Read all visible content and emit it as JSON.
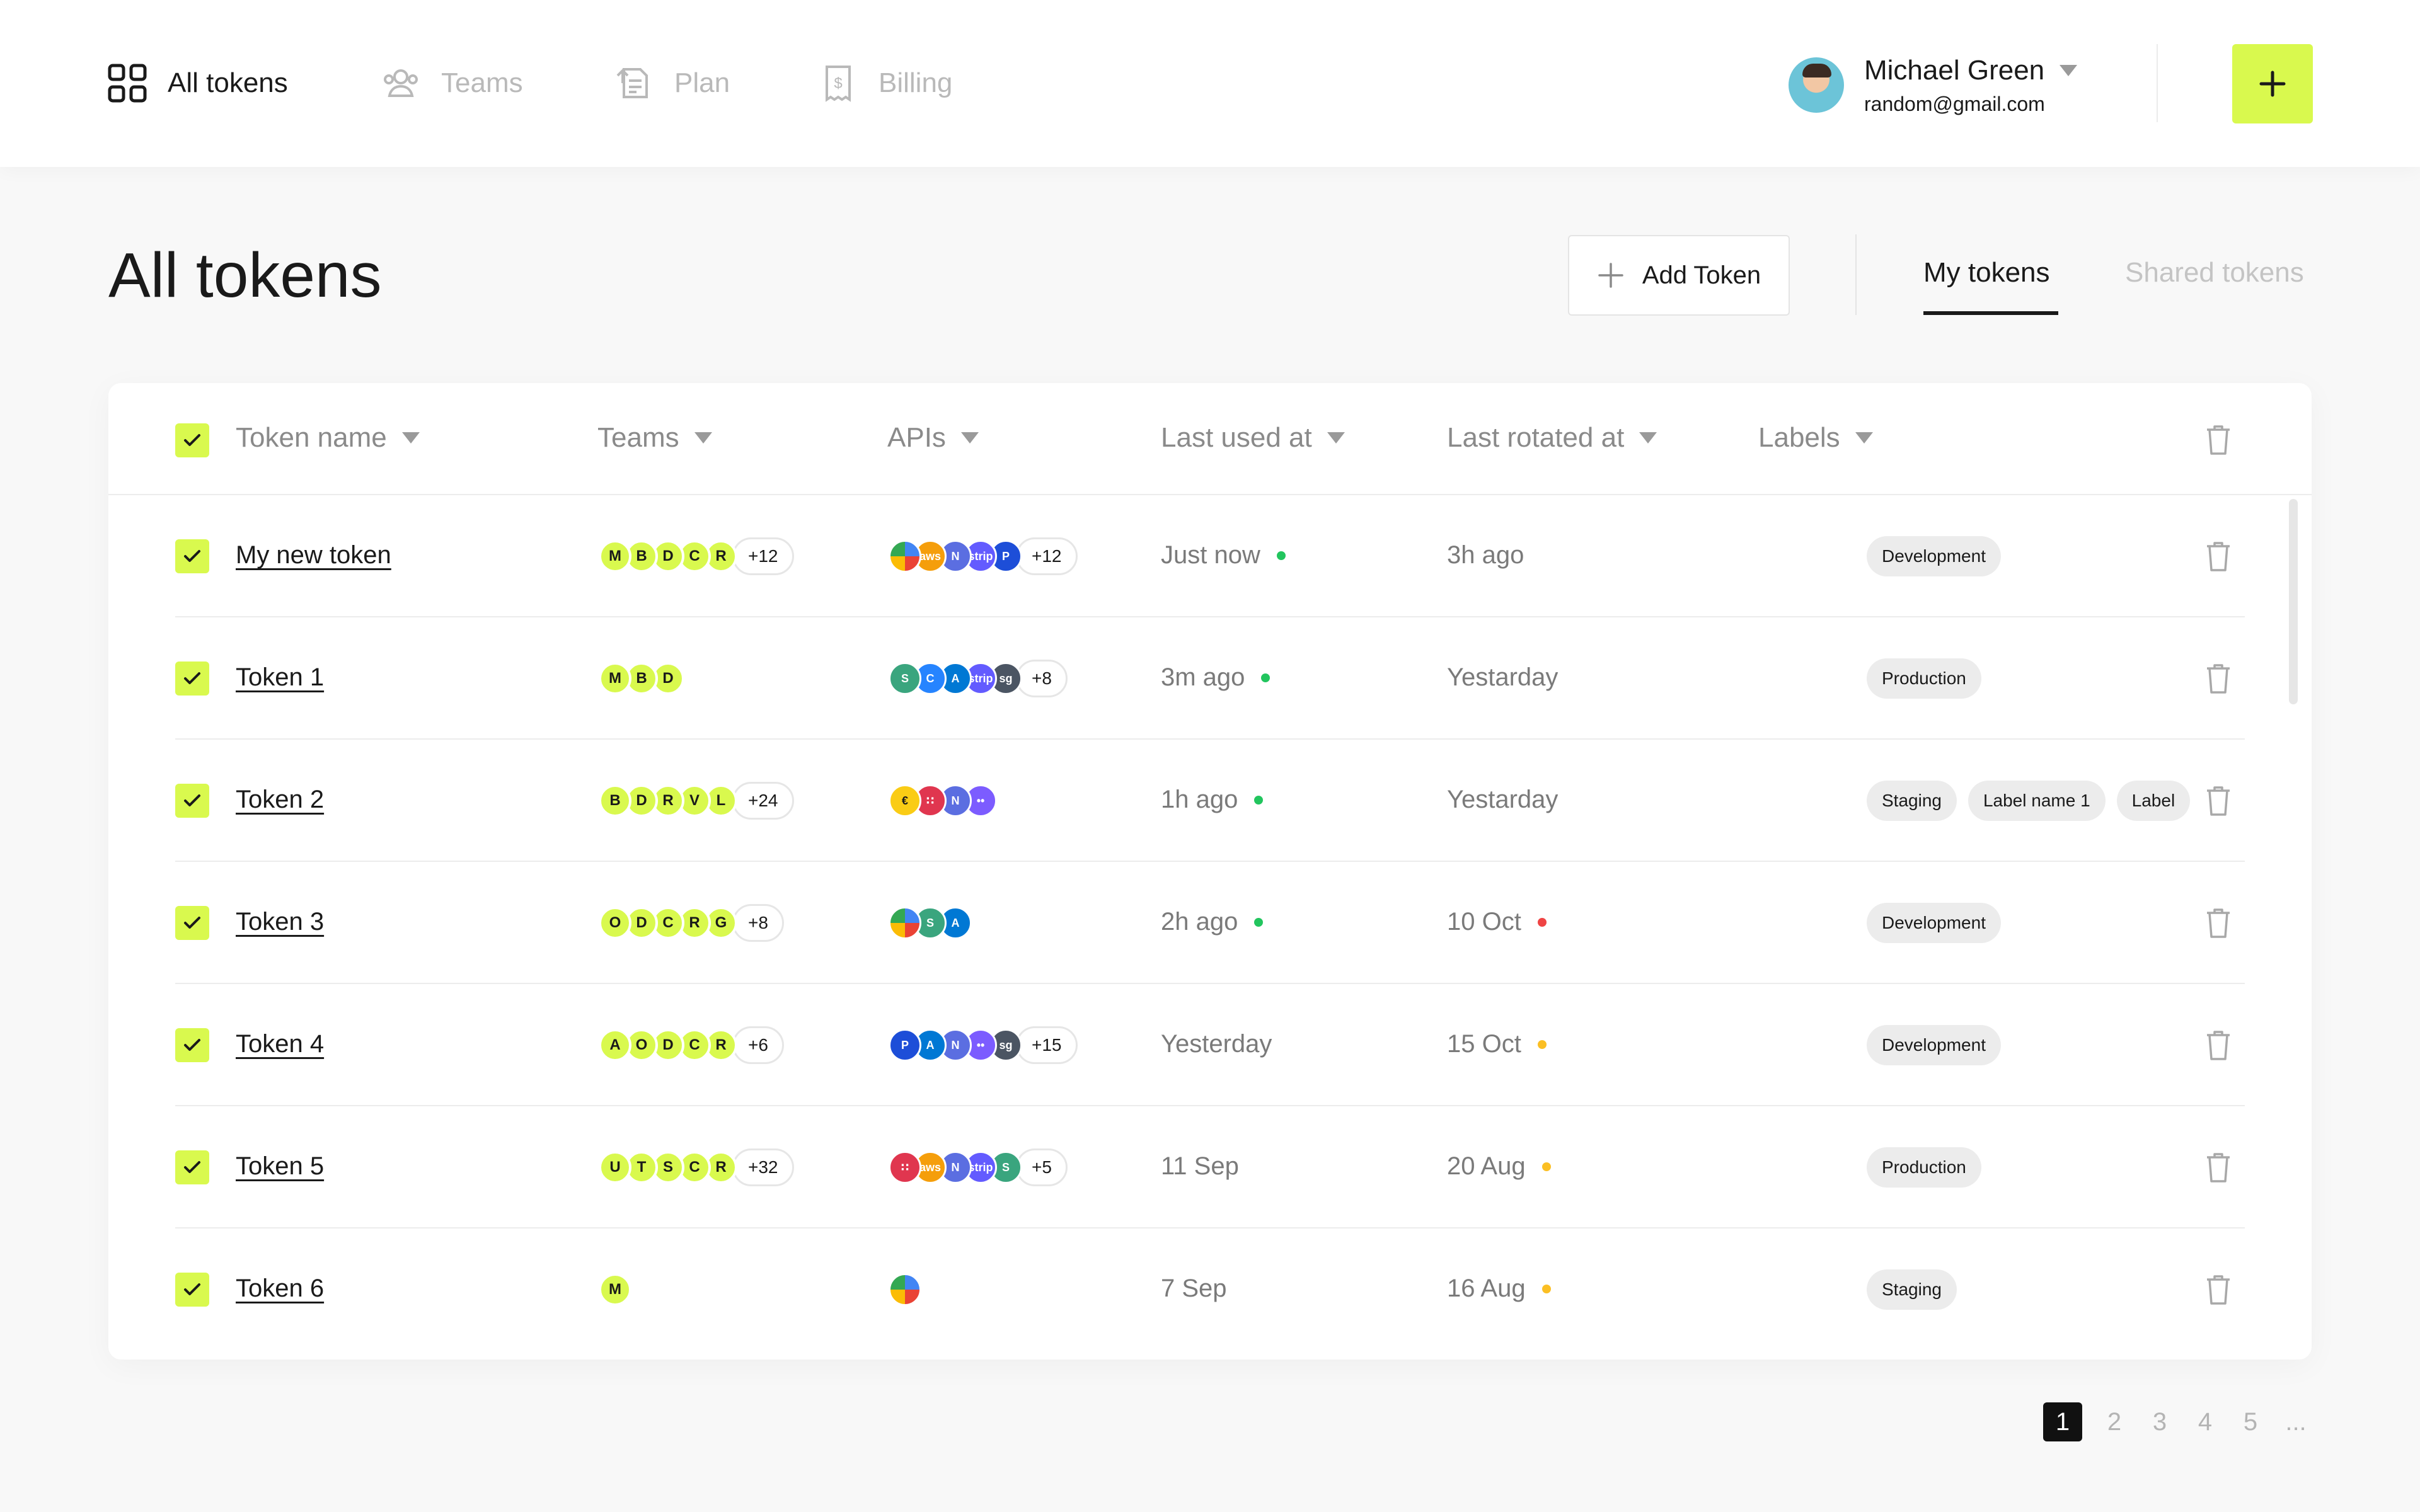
{
  "nav": {
    "items": [
      {
        "label": "All tokens",
        "icon": "grid-icon",
        "active": true
      },
      {
        "label": "Teams",
        "icon": "users-icon",
        "active": false
      },
      {
        "label": "Plan",
        "icon": "plan-icon",
        "active": false
      },
      {
        "label": "Billing",
        "icon": "receipt-icon",
        "active": false
      }
    ]
  },
  "user": {
    "name": "Michael Green",
    "email": "random@gmail.com"
  },
  "header": {
    "title": "All tokens",
    "add_token_label": "Add Token",
    "tabs": [
      "My tokens",
      "Shared tokens"
    ],
    "active_tab": "My tokens"
  },
  "table": {
    "columns": [
      "Token name",
      "Teams",
      "APIs",
      "Last used at",
      "Last rotated at",
      "Labels"
    ],
    "rows": [
      {
        "name": "My new token",
        "teams": [
          "M",
          "B",
          "D",
          "C",
          "R"
        ],
        "teams_more": "+12",
        "apis": [
          "gcloud",
          "aws",
          "notion",
          "stripe",
          "paypal"
        ],
        "apis_more": "+12",
        "last_used": "Just now",
        "last_used_status": "#22c55e",
        "last_rotated": "3h ago",
        "last_rotated_status": "",
        "labels": [
          "Development"
        ]
      },
      {
        "name": "Token 1",
        "teams": [
          "M",
          "B",
          "D"
        ],
        "teams_more": "",
        "apis": [
          "sendgrid-s",
          "confluence",
          "azure",
          "stripe",
          "sendgrid"
        ],
        "apis_more": "+8",
        "last_used": "3m ago",
        "last_used_status": "#22c55e",
        "last_rotated": "Yestarday",
        "last_rotated_status": "",
        "labels": [
          "Production"
        ]
      },
      {
        "name": "Token 2",
        "teams": [
          "B",
          "D",
          "R",
          "V",
          "L"
        ],
        "teams_more": "+24",
        "apis": [
          "euro",
          "twilio",
          "notion",
          "dots"
        ],
        "apis_more": "",
        "last_used": "1h ago",
        "last_used_status": "#22c55e",
        "last_rotated": "Yestarday",
        "last_rotated_status": "",
        "labels": [
          "Staging",
          "Label name 1",
          "Label"
        ]
      },
      {
        "name": "Token 3",
        "teams": [
          "O",
          "D",
          "C",
          "R",
          "G"
        ],
        "teams_more": "+8",
        "apis": [
          "gcloud",
          "sendgrid-s",
          "azure"
        ],
        "apis_more": "",
        "last_used": "2h ago",
        "last_used_status": "#22c55e",
        "last_rotated": "10 Oct",
        "last_rotated_status": "#ef4444",
        "labels": [
          "Development"
        ]
      },
      {
        "name": "Token 4",
        "teams": [
          "A",
          "O",
          "D",
          "C",
          "R"
        ],
        "teams_more": "+6",
        "apis": [
          "paypal",
          "azure",
          "notion",
          "dots",
          "sendgrid"
        ],
        "apis_more": "+15",
        "last_used": "Yesterday",
        "last_used_status": "",
        "last_rotated": "15 Oct",
        "last_rotated_status": "#fbbf24",
        "labels": [
          "Development"
        ]
      },
      {
        "name": "Token 5",
        "teams": [
          "U",
          "T",
          "S",
          "C",
          "R"
        ],
        "teams_more": "+32",
        "apis": [
          "twilio",
          "aws",
          "notion",
          "stripe",
          "sendgrid-s"
        ],
        "apis_more": "+5",
        "last_used": "11 Sep",
        "last_used_status": "",
        "last_rotated": "20 Aug",
        "last_rotated_status": "#fbbf24",
        "labels": [
          "Production"
        ]
      },
      {
        "name": "Token 6",
        "teams": [
          "M"
        ],
        "teams_more": "",
        "apis": [
          "gcloud"
        ],
        "apis_more": "",
        "last_used": "7 Sep",
        "last_used_status": "",
        "last_rotated": "16 Aug",
        "last_rotated_status": "#fbbf24",
        "labels": [
          "Staging"
        ]
      }
    ]
  },
  "pagination": {
    "pages": [
      "1",
      "2",
      "3",
      "4",
      "5",
      "..."
    ],
    "current": "1"
  },
  "colors": {
    "accent": "#d9f94e",
    "status_green": "#22c55e",
    "status_red": "#ef4444",
    "status_yellow": "#fbbf24"
  }
}
